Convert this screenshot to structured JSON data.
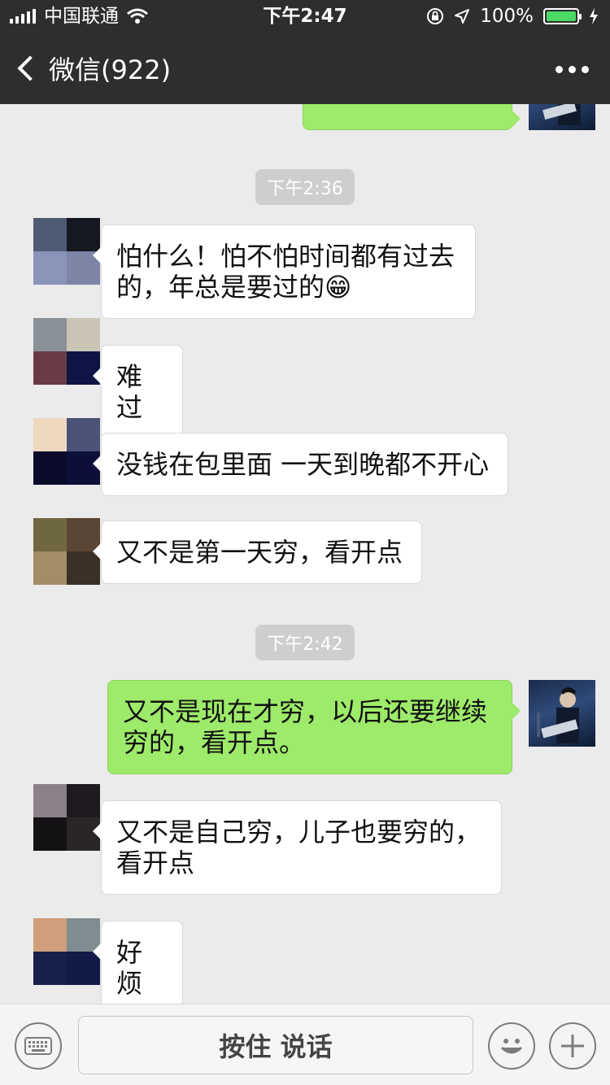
{
  "status_bar": {
    "carrier": "中国联通",
    "time": "下午2:47",
    "battery": "100%"
  },
  "nav": {
    "back_label": "微信(922)"
  },
  "chat": {
    "timestamps": [
      "下午2:36",
      "下午2:42"
    ],
    "messages": [
      {
        "side": "left",
        "text": "怕什么！怕不怕时间都有过去的，年总是要过的😁"
      },
      {
        "side": "left",
        "text": "难过"
      },
      {
        "side": "left",
        "text": "没钱在包里面 一天到晚都不开心"
      },
      {
        "side": "left",
        "text": "又不是第一天穷，看开点"
      },
      {
        "side": "right",
        "text": "又不是现在才穷，以后还要继续穷的，看开点。"
      },
      {
        "side": "left",
        "text": "又不是自己穷，儿子也要穷的，看开点"
      },
      {
        "side": "left",
        "text": "好烦"
      }
    ]
  },
  "input_bar": {
    "voice_label": "按住 说话"
  },
  "colors": {
    "nav_bg": "#2e2e2e",
    "chat_bg": "#ebebeb",
    "my_bubble": "#9eea6a",
    "their_bubble": "#ffffff",
    "battery_fill": "#4cd964"
  }
}
